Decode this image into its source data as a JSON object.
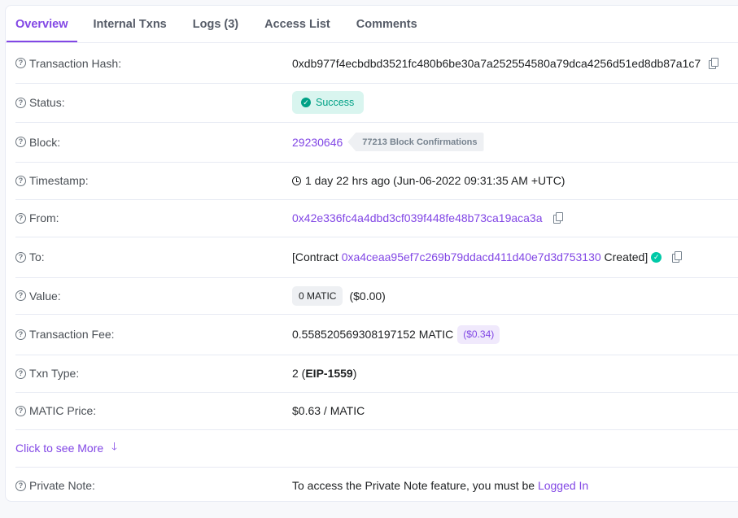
{
  "tabs": [
    {
      "label": "Overview",
      "active": true
    },
    {
      "label": "Internal Txns"
    },
    {
      "label": "Logs (3)"
    },
    {
      "label": "Access List"
    },
    {
      "label": "Comments"
    }
  ],
  "rows": {
    "hash": {
      "label": "Transaction Hash:",
      "value": "0xdb977f4ecbdbd3521fc480b6be30a7a252554580a79dca4256d51ed8db87a1c7"
    },
    "status": {
      "label": "Status:",
      "value": "Success"
    },
    "block": {
      "label": "Block:",
      "value": "29230646",
      "confirmations": "77213 Block Confirmations"
    },
    "timestamp": {
      "label": "Timestamp:",
      "value": "1 day 22 hrs ago (Jun-06-2022 09:31:35 AM +UTC)"
    },
    "from": {
      "label": "From:",
      "value": "0x42e336fc4a4dbd3cf039f448fe48b73ca19aca3a"
    },
    "to": {
      "label": "To:",
      "prefix": "[Contract",
      "address": "0xa4ceaa95ef7c269b79ddacd411d40e7d3d753130",
      "suffix": "Created]"
    },
    "value": {
      "label": "Value:",
      "amount": "0 MATIC",
      "usd": "($0.00)"
    },
    "fee": {
      "label": "Transaction Fee:",
      "value": "0.558520569308197152 MATIC",
      "usd": "($0.34)"
    },
    "txn_type": {
      "label": "Txn Type:",
      "prefix": "2 (",
      "type": "EIP-1559",
      "suffix": ")"
    },
    "price": {
      "label": "MATIC Price:",
      "value": "$0.63 / MATIC"
    },
    "see_more": {
      "label": "Click to see More"
    },
    "note": {
      "label": "Private Note:",
      "text": "To access the Private Note feature, you must be",
      "link": "Logged In"
    }
  },
  "colors": {
    "accent": "#8247e5",
    "success": "#00a186"
  }
}
